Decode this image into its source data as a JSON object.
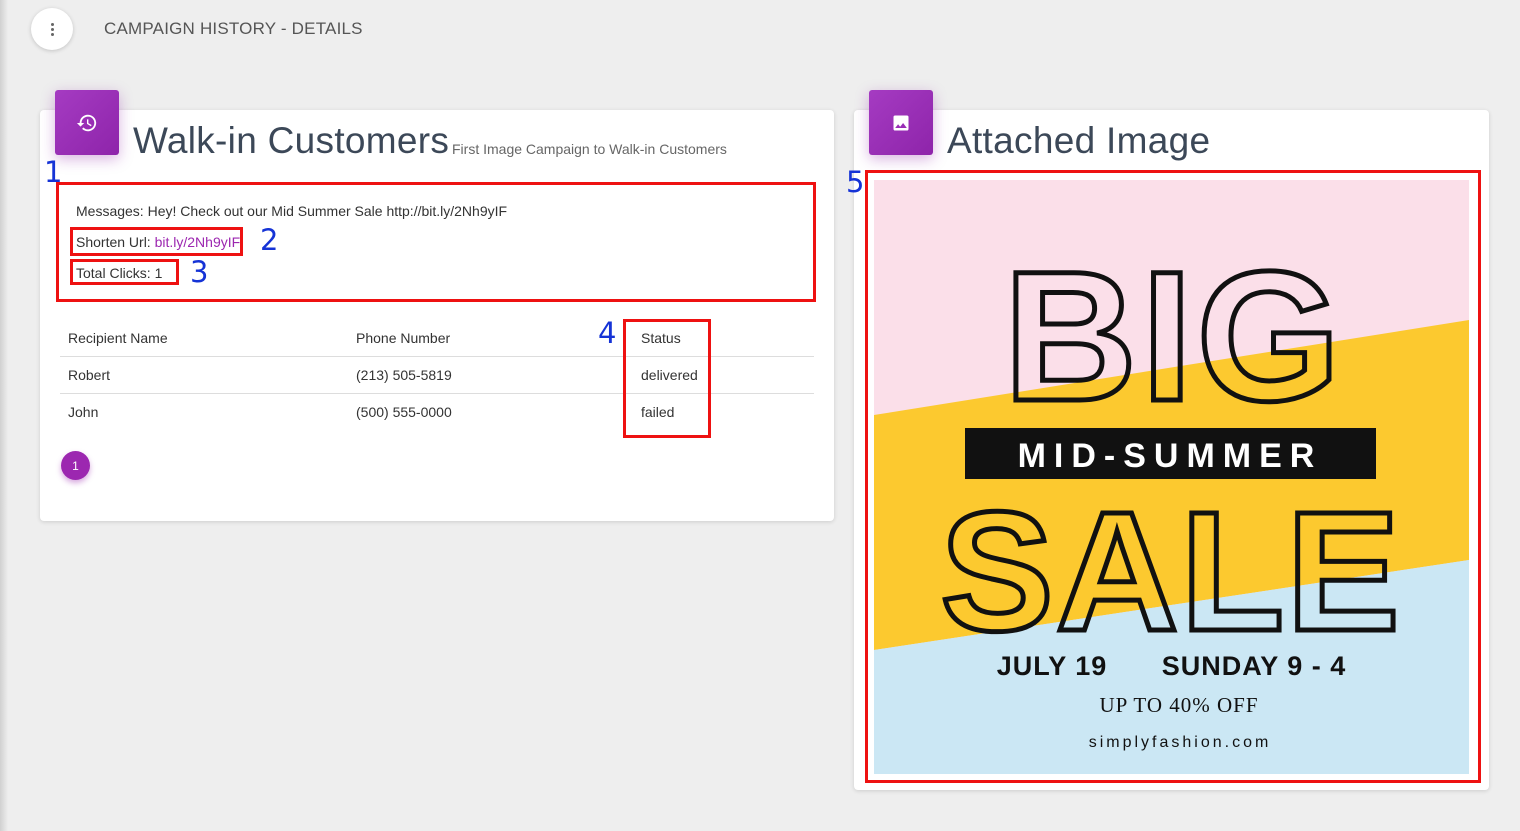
{
  "header": {
    "title": "CAMPAIGN HISTORY - DETAILS",
    "menu_icon": "more-vert-icon"
  },
  "campaign": {
    "icon": "history-icon",
    "title": "Walk-in Customers",
    "subtitle": "First Image Campaign to Walk-in Customers",
    "message_label": "Messages: Hey! Check out our Mid Summer Sale http://bit.ly/2Nh9yIF",
    "shorten_label": "Shorten Url: ",
    "shorten_url": "bit.ly/2Nh9yIF",
    "clicks_label": "Total Clicks: 1"
  },
  "table": {
    "columns": [
      "Recipient Name",
      "Phone Number",
      "Status"
    ],
    "rows": [
      [
        "Robert",
        "(213) 505-5819",
        "delivered"
      ],
      [
        "John",
        "(500) 555-0000",
        "failed"
      ]
    ]
  },
  "pagination": {
    "current": "1"
  },
  "attached": {
    "icon": "image-icon",
    "title": "Attached Image",
    "poster": {
      "big": "BIG",
      "banner": "MID-SUMMER",
      "sale": "SALE",
      "date": "JULY 19",
      "hours": "SUNDAY 9 - 4",
      "offer": "UP TO 40% OFF",
      "site": "simplyfashion.com"
    }
  },
  "annotations": [
    "1",
    "2",
    "3",
    "4",
    "5"
  ],
  "colors": {
    "accent": "#9c27b0",
    "annotation_box": "#ee1111",
    "annotation_num": "#1533d6"
  }
}
